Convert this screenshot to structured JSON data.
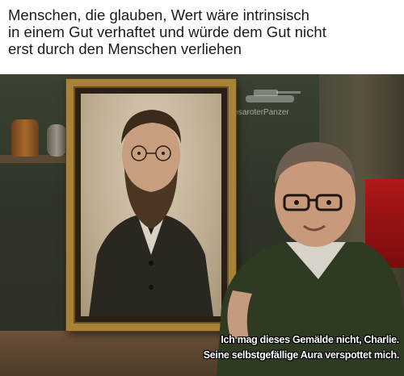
{
  "caption_top": {
    "lines": [
      "Menschen, die glauben, Wert wäre intrinsisch",
      "in einem Gut verhaftet und würde dem Gut nicht",
      "erst durch den Menschen verliehen"
    ]
  },
  "watermark": {
    "text": "@RosaroterPanzer",
    "icon": "tank-icon"
  },
  "caption_bottom": {
    "lines": [
      "Ich mag dieses Gemälde nicht, Charlie.",
      "Seine selbstgefällige Aura verspottet mich."
    ]
  },
  "colors": {
    "frame_gold": "#a88238",
    "sweater_green": "#2f3a23",
    "caption_text": "#ffffff"
  }
}
